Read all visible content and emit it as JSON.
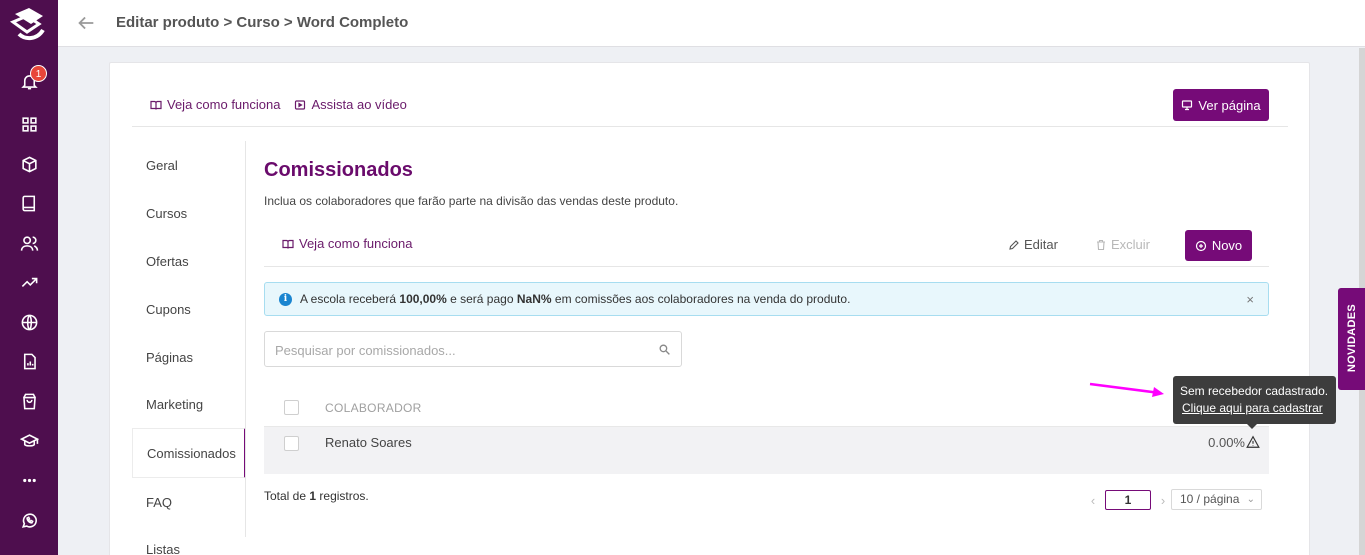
{
  "header": {
    "breadcrumb": "Editar produto > Curso > Word Completo"
  },
  "sidebar": {
    "notification_count": "1",
    "icons": [
      "bell-icon",
      "grid-icon",
      "box-icon",
      "book-icon",
      "users-icon",
      "trending-icon",
      "globe-icon",
      "report-icon",
      "shopping-bag-icon",
      "graduation-cap-icon",
      "more-icon",
      "whatsapp-icon"
    ]
  },
  "card": {
    "link_how_it_works": "Veja como funciona",
    "link_watch_video": "Assista ao vídeo",
    "view_page_button": "Ver página"
  },
  "menu": {
    "items": [
      "Geral",
      "Cursos",
      "Ofertas",
      "Cupons",
      "Páginas",
      "Marketing",
      "Comissionados",
      "FAQ",
      "Listas"
    ],
    "active": "Comissionados"
  },
  "section": {
    "title": "Comissionados",
    "description": "Inclua os colaboradores que farão parte na divisão das vendas deste produto.",
    "how_it_works": "Veja como funciona",
    "edit_label": "Editar",
    "delete_label": "Excluir",
    "new_label": "Novo"
  },
  "alert": {
    "prefix": "A escola receberá",
    "school_pct": "100,00%",
    "middle": "e será pago",
    "commission_pct": "NaN%",
    "suffix": "em comissões aos colaboradores na venda do produto.",
    "close": "×"
  },
  "search": {
    "placeholder": "Pesquisar por comissionados...",
    "value": ""
  },
  "table": {
    "column_header": "COLABORADOR",
    "rows": [
      {
        "name": "Renato Soares",
        "percent": "0.00%"
      }
    ]
  },
  "footer": {
    "total_prefix": "Total de",
    "total_count": "1",
    "total_suffix": "registros.",
    "page": "1",
    "page_size": "10 / página"
  },
  "tooltip": {
    "line1": "Sem recebedor cadastrado.",
    "link": "Clique aqui para cadastrar"
  },
  "side_tab": {
    "label": "NOVIDADES"
  },
  "colors": {
    "sidebar": "#4e0e4e",
    "accent": "#760b78",
    "title": "#6a0b6c",
    "annotation_arrow": "#ff00ff"
  }
}
